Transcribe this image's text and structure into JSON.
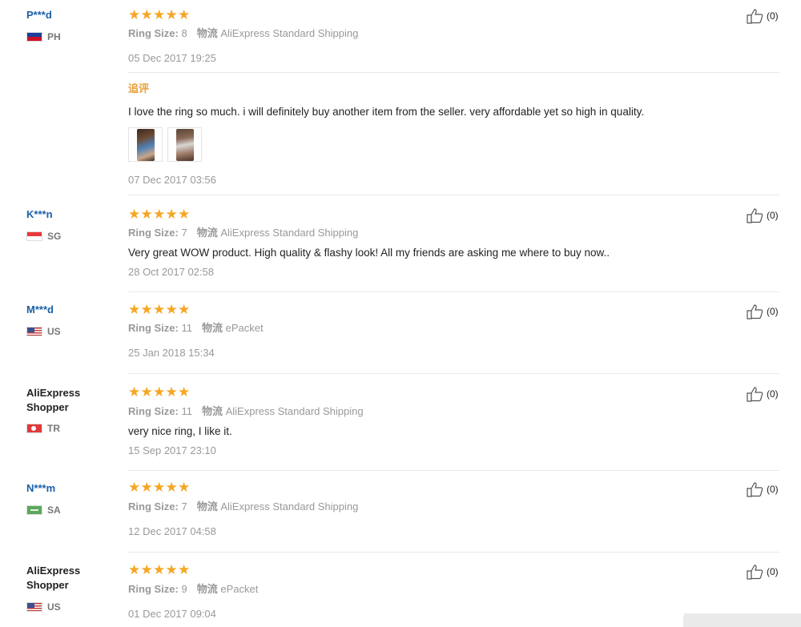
{
  "reviews": [
    {
      "name": "P***d",
      "country": "PH",
      "ring_size_label": "Ring Size:",
      "ring_size": "8",
      "shipping_label": "物流",
      "shipping": "AliExpress Standard Shipping",
      "date": "05 Dec 2017 19:25",
      "followup_label": "追评",
      "followup_text": "I love the ring so much. i will definitely buy another item from the seller. very affordable yet so high in quality.",
      "followup_date": "07 Dec 2017 03:56",
      "helpful": "(0)"
    },
    {
      "name": "K***n",
      "country": "SG",
      "ring_size_label": "Ring Size:",
      "ring_size": "7",
      "shipping_label": "物流",
      "shipping": "AliExpress Standard Shipping",
      "text": "Very great WOW product. High quality & flashy look! All my friends are asking me where to buy now..",
      "date": "28 Oct 2017 02:58",
      "helpful": "(0)"
    },
    {
      "name": "M***d",
      "country": "US",
      "ring_size_label": "Ring Size:",
      "ring_size": "11",
      "shipping_label": "物流",
      "shipping": "ePacket",
      "date": "25 Jan 2018 15:34",
      "helpful": "(0)"
    },
    {
      "name": "AliExpress Shopper",
      "country": "TR",
      "ring_size_label": "Ring Size:",
      "ring_size": "11",
      "shipping_label": "物流",
      "shipping": "AliExpress Standard Shipping",
      "text": "very nice ring, I like it.",
      "date": "15 Sep 2017 23:10",
      "helpful": "(0)"
    },
    {
      "name": "N***m",
      "country": "SA",
      "ring_size_label": "Ring Size:",
      "ring_size": "7",
      "shipping_label": "物流",
      "shipping": "AliExpress Standard Shipping",
      "date": "12 Dec 2017 04:58",
      "helpful": "(0)"
    },
    {
      "name": "AliExpress Shopper",
      "country": "US",
      "ring_size_label": "Ring Size:",
      "ring_size": "9",
      "shipping_label": "物流",
      "shipping": "ePacket",
      "date": "01 Dec 2017 09:04",
      "helpful": "(0)"
    }
  ],
  "rating_stars": 5,
  "colors": {
    "star": "#f5a623",
    "name_link": "#1a5fa8",
    "followup": "#e6a23c"
  }
}
